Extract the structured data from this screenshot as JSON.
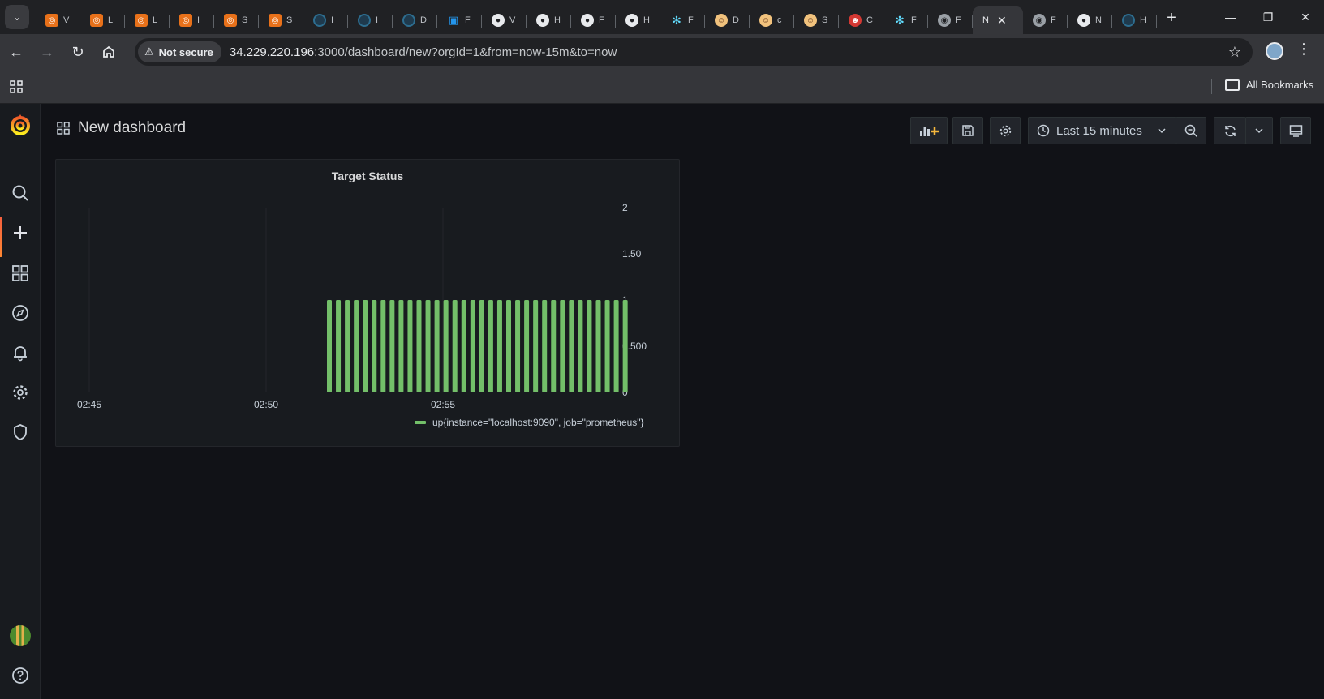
{
  "browser": {
    "tabs": [
      {
        "icon": "orange",
        "letter": "V"
      },
      {
        "icon": "orange",
        "letter": "L"
      },
      {
        "icon": "orange",
        "letter": "L"
      },
      {
        "icon": "orange",
        "letter": "I"
      },
      {
        "icon": "orange",
        "letter": "S"
      },
      {
        "icon": "orange",
        "letter": "S"
      },
      {
        "icon": "circle",
        "letter": "I"
      },
      {
        "icon": "circle",
        "letter": "I"
      },
      {
        "icon": "circle",
        "letter": "D"
      },
      {
        "icon": "docker",
        "letter": "F"
      },
      {
        "icon": "github",
        "letter": "V"
      },
      {
        "icon": "github",
        "letter": "H"
      },
      {
        "icon": "github",
        "letter": "F"
      },
      {
        "icon": "github",
        "letter": "H"
      },
      {
        "icon": "react",
        "letter": "F"
      },
      {
        "icon": "face",
        "letter": "D"
      },
      {
        "icon": "face",
        "letter": "c"
      },
      {
        "icon": "face",
        "letter": "S"
      },
      {
        "icon": "jenkins",
        "letter": "C"
      },
      {
        "icon": "react",
        "letter": "F"
      },
      {
        "icon": "globe",
        "letter": "F"
      },
      {
        "icon": "none",
        "letter": "N",
        "active": true
      },
      {
        "icon": "globe",
        "letter": "F"
      },
      {
        "icon": "github",
        "letter": "N"
      },
      {
        "icon": "circle",
        "letter": "H"
      }
    ],
    "new_tab_label": "+",
    "security_label": "Not secure",
    "url_host": "34.229.220.196",
    "url_rest": ":3000/dashboard/new?orgId=1&from=now-15m&to=now",
    "all_bookmarks_label": "All Bookmarks"
  },
  "dashboard": {
    "title": "New dashboard",
    "time_range_label": "Last 15 minutes"
  },
  "panel": {
    "title": "Target Status",
    "legend_label": "up{instance=\"localhost:9090\", job=\"prometheus\"}"
  },
  "colors": {
    "series": "#73bf69",
    "accent": "#f55f3e",
    "background": "#111217",
    "panel": "#181b1f"
  },
  "chart_data": {
    "type": "bar",
    "title": "Target Status",
    "x_ticks": [
      "02:45",
      "02:50",
      "02:55"
    ],
    "y_ticks": [
      "0",
      "0.500",
      "1",
      "1.50",
      "2"
    ],
    "ylim": [
      0,
      2
    ],
    "y_axis_side": "right",
    "legend_position": "bottom",
    "series": [
      {
        "name": "up{instance=\"localhost:9090\", job=\"prometheus\"}",
        "color": "#73bf69",
        "values": [
          1,
          1,
          1,
          1,
          1,
          1,
          1,
          1,
          1,
          1,
          1,
          1,
          1,
          1,
          1,
          1,
          1,
          1,
          1,
          1,
          1,
          1,
          1,
          1,
          1,
          1,
          1,
          1,
          1,
          1,
          1,
          1,
          1,
          1
        ]
      }
    ]
  }
}
